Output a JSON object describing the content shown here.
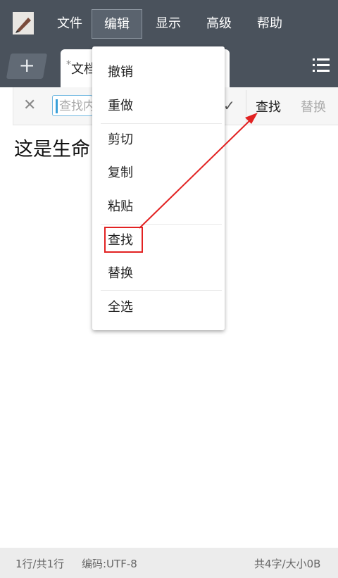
{
  "menubar": {
    "items": [
      {
        "label": "文件"
      },
      {
        "label": "编辑"
      },
      {
        "label": "显示"
      },
      {
        "label": "高级"
      },
      {
        "label": "帮助"
      }
    ]
  },
  "tabs": {
    "add_label": "+",
    "document_tab": {
      "modified_marker": "*",
      "label": "文档"
    }
  },
  "findbar": {
    "input_placeholder": "查找内",
    "find_label": "查找",
    "replace_label": "替换"
  },
  "document": {
    "text": "这是生命"
  },
  "edit_menu": {
    "items": [
      {
        "label": "撤销"
      },
      {
        "label": "重做"
      },
      {
        "label": "剪切"
      },
      {
        "label": "复制"
      },
      {
        "label": "粘贴"
      },
      {
        "label": "查找"
      },
      {
        "label": "替换"
      },
      {
        "label": "全选"
      }
    ]
  },
  "statusbar": {
    "line_info": "1行/共1行",
    "encoding": "编码:UTF-8",
    "size_info": "共4字/大小0B"
  },
  "colors": {
    "toolbar_bg": "#4a525c",
    "annotation_red": "#e22222",
    "input_focus": "#6fb7e0"
  }
}
